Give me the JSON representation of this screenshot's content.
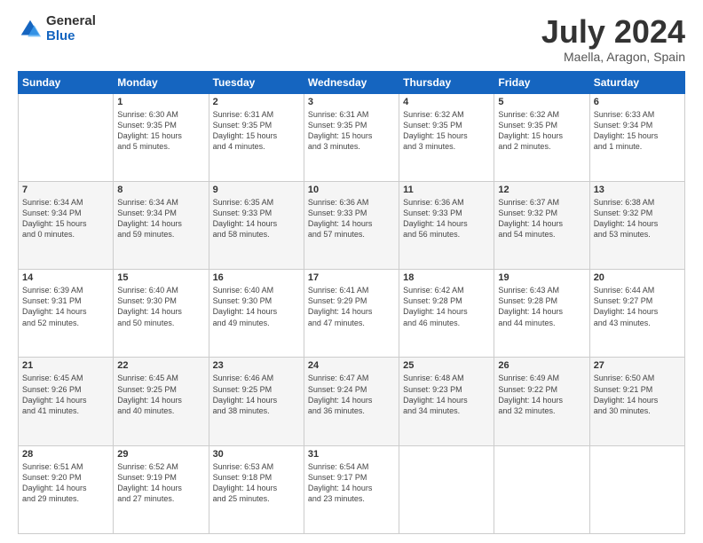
{
  "logo": {
    "general": "General",
    "blue": "Blue"
  },
  "title": "July 2024",
  "subtitle": "Maella, Aragon, Spain",
  "headers": [
    "Sunday",
    "Monday",
    "Tuesday",
    "Wednesday",
    "Thursday",
    "Friday",
    "Saturday"
  ],
  "weeks": [
    [
      {
        "day": "",
        "info": ""
      },
      {
        "day": "1",
        "info": "Sunrise: 6:30 AM\nSunset: 9:35 PM\nDaylight: 15 hours\nand 5 minutes."
      },
      {
        "day": "2",
        "info": "Sunrise: 6:31 AM\nSunset: 9:35 PM\nDaylight: 15 hours\nand 4 minutes."
      },
      {
        "day": "3",
        "info": "Sunrise: 6:31 AM\nSunset: 9:35 PM\nDaylight: 15 hours\nand 3 minutes."
      },
      {
        "day": "4",
        "info": "Sunrise: 6:32 AM\nSunset: 9:35 PM\nDaylight: 15 hours\nand 3 minutes."
      },
      {
        "day": "5",
        "info": "Sunrise: 6:32 AM\nSunset: 9:35 PM\nDaylight: 15 hours\nand 2 minutes."
      },
      {
        "day": "6",
        "info": "Sunrise: 6:33 AM\nSunset: 9:34 PM\nDaylight: 15 hours\nand 1 minute."
      }
    ],
    [
      {
        "day": "7",
        "info": "Sunrise: 6:34 AM\nSunset: 9:34 PM\nDaylight: 15 hours\nand 0 minutes."
      },
      {
        "day": "8",
        "info": "Sunrise: 6:34 AM\nSunset: 9:34 PM\nDaylight: 14 hours\nand 59 minutes."
      },
      {
        "day": "9",
        "info": "Sunrise: 6:35 AM\nSunset: 9:33 PM\nDaylight: 14 hours\nand 58 minutes."
      },
      {
        "day": "10",
        "info": "Sunrise: 6:36 AM\nSunset: 9:33 PM\nDaylight: 14 hours\nand 57 minutes."
      },
      {
        "day": "11",
        "info": "Sunrise: 6:36 AM\nSunset: 9:33 PM\nDaylight: 14 hours\nand 56 minutes."
      },
      {
        "day": "12",
        "info": "Sunrise: 6:37 AM\nSunset: 9:32 PM\nDaylight: 14 hours\nand 54 minutes."
      },
      {
        "day": "13",
        "info": "Sunrise: 6:38 AM\nSunset: 9:32 PM\nDaylight: 14 hours\nand 53 minutes."
      }
    ],
    [
      {
        "day": "14",
        "info": "Sunrise: 6:39 AM\nSunset: 9:31 PM\nDaylight: 14 hours\nand 52 minutes."
      },
      {
        "day": "15",
        "info": "Sunrise: 6:40 AM\nSunset: 9:30 PM\nDaylight: 14 hours\nand 50 minutes."
      },
      {
        "day": "16",
        "info": "Sunrise: 6:40 AM\nSunset: 9:30 PM\nDaylight: 14 hours\nand 49 minutes."
      },
      {
        "day": "17",
        "info": "Sunrise: 6:41 AM\nSunset: 9:29 PM\nDaylight: 14 hours\nand 47 minutes."
      },
      {
        "day": "18",
        "info": "Sunrise: 6:42 AM\nSunset: 9:28 PM\nDaylight: 14 hours\nand 46 minutes."
      },
      {
        "day": "19",
        "info": "Sunrise: 6:43 AM\nSunset: 9:28 PM\nDaylight: 14 hours\nand 44 minutes."
      },
      {
        "day": "20",
        "info": "Sunrise: 6:44 AM\nSunset: 9:27 PM\nDaylight: 14 hours\nand 43 minutes."
      }
    ],
    [
      {
        "day": "21",
        "info": "Sunrise: 6:45 AM\nSunset: 9:26 PM\nDaylight: 14 hours\nand 41 minutes."
      },
      {
        "day": "22",
        "info": "Sunrise: 6:45 AM\nSunset: 9:25 PM\nDaylight: 14 hours\nand 40 minutes."
      },
      {
        "day": "23",
        "info": "Sunrise: 6:46 AM\nSunset: 9:25 PM\nDaylight: 14 hours\nand 38 minutes."
      },
      {
        "day": "24",
        "info": "Sunrise: 6:47 AM\nSunset: 9:24 PM\nDaylight: 14 hours\nand 36 minutes."
      },
      {
        "day": "25",
        "info": "Sunrise: 6:48 AM\nSunset: 9:23 PM\nDaylight: 14 hours\nand 34 minutes."
      },
      {
        "day": "26",
        "info": "Sunrise: 6:49 AM\nSunset: 9:22 PM\nDaylight: 14 hours\nand 32 minutes."
      },
      {
        "day": "27",
        "info": "Sunrise: 6:50 AM\nSunset: 9:21 PM\nDaylight: 14 hours\nand 30 minutes."
      }
    ],
    [
      {
        "day": "28",
        "info": "Sunrise: 6:51 AM\nSunset: 9:20 PM\nDaylight: 14 hours\nand 29 minutes."
      },
      {
        "day": "29",
        "info": "Sunrise: 6:52 AM\nSunset: 9:19 PM\nDaylight: 14 hours\nand 27 minutes."
      },
      {
        "day": "30",
        "info": "Sunrise: 6:53 AM\nSunset: 9:18 PM\nDaylight: 14 hours\nand 25 minutes."
      },
      {
        "day": "31",
        "info": "Sunrise: 6:54 AM\nSunset: 9:17 PM\nDaylight: 14 hours\nand 23 minutes."
      },
      {
        "day": "",
        "info": ""
      },
      {
        "day": "",
        "info": ""
      },
      {
        "day": "",
        "info": ""
      }
    ]
  ]
}
